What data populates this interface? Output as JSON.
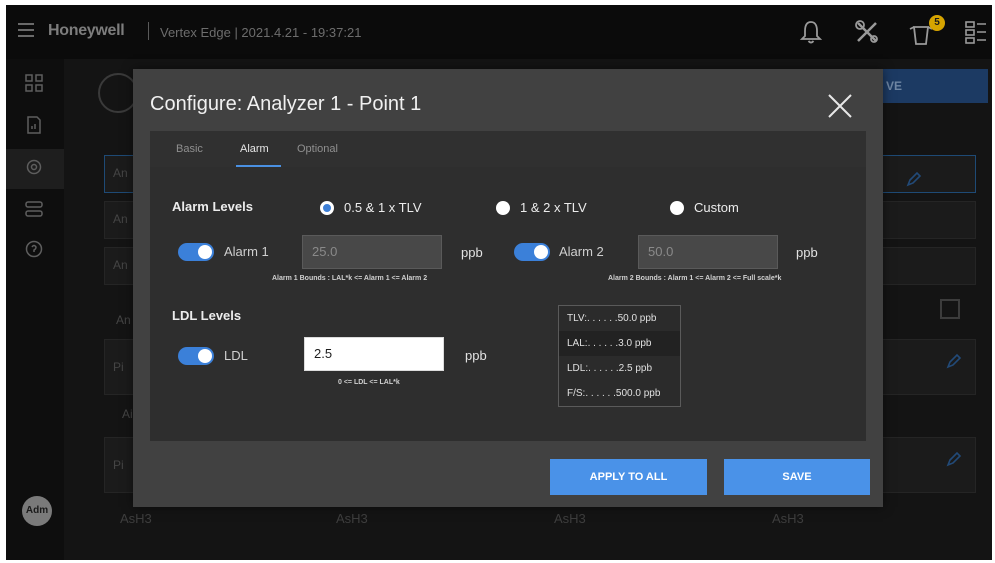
{
  "topbar": {
    "brand": "Honeywell",
    "title": "Vertex Edge | 2021.4.21 - 19:37:21",
    "notification_badge": "5"
  },
  "sidebar": {
    "avatar_label": "Adm"
  },
  "background": {
    "save_label": "VE",
    "row_labels": [
      "An",
      "An",
      "An",
      "An",
      "Pi",
      "Ai",
      "Pi"
    ],
    "asg_labels": [
      "AsH3",
      "AsH3",
      "AsH3",
      "AsH3"
    ]
  },
  "modal": {
    "title": "Configure: Analyzer 1 - Point 1",
    "tabs": [
      "Basic",
      "Alarm",
      "Optional"
    ],
    "active_tab": "Alarm",
    "alarm_levels": {
      "heading": "Alarm Levels",
      "options": [
        "0.5 & 1 x TLV",
        "1 & 2 x TLV",
        "Custom"
      ],
      "selected": "0.5 & 1 x TLV",
      "alarm1": {
        "label": "Alarm 1",
        "value": "25.0",
        "unit": "ppb",
        "hint": "Alarm 1 Bounds : LAL*k <= Alarm 1 <= Alarm 2",
        "enabled": true
      },
      "alarm2": {
        "label": "Alarm 2",
        "value": "50.0",
        "unit": "ppb",
        "hint": "Alarm 2 Bounds : Alarm 1 <= Alarm 2 <= Full scale*k",
        "enabled": true
      }
    },
    "ldl_levels": {
      "heading": "LDL Levels",
      "label": "LDL",
      "value": "2.5",
      "unit": "ppb",
      "hint": "0 <= LDL <= LAL*k",
      "enabled": true
    },
    "reference": [
      "TLV:. . . . . .50.0 ppb",
      "LAL:. . . . . .3.0 ppb",
      "LDL:. . . . . .2.5 ppb",
      "F/S:. . . . . .500.0 ppb"
    ],
    "buttons": {
      "apply_all": "APPLY TO ALL",
      "save": "SAVE"
    }
  },
  "colors": {
    "accent": "#4a92e8",
    "toggle": "#3b80d9",
    "modal_bg": "#414141",
    "panel_bg": "#2e2e2e"
  }
}
